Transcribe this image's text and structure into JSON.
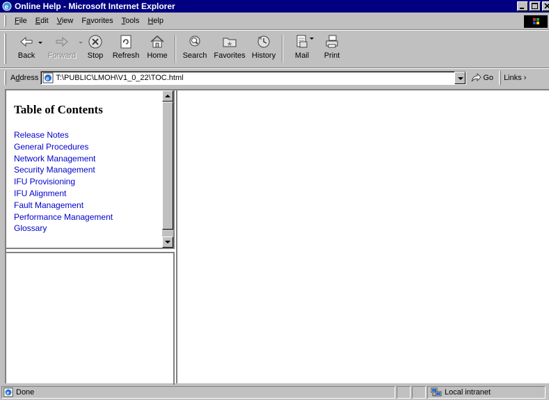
{
  "window": {
    "title": "Online Help - Microsoft Internet Explorer"
  },
  "menu": {
    "items": [
      {
        "key": "F",
        "rest": "ile"
      },
      {
        "key": "E",
        "rest": "dit"
      },
      {
        "key": "V",
        "rest": "iew"
      },
      {
        "pre": "F",
        "key": "a",
        "rest": "vorites"
      },
      {
        "key": "T",
        "rest": "ools"
      },
      {
        "key": "H",
        "rest": "elp"
      }
    ]
  },
  "toolbar": {
    "back": "Back",
    "forward": "Forward",
    "stop": "Stop",
    "refresh": "Refresh",
    "home": "Home",
    "search": "Search",
    "favorites": "Favorites",
    "history": "History",
    "mail": "Mail",
    "print": "Print"
  },
  "address": {
    "label_key": "d",
    "label_pre": "A",
    "label_rest": "dress",
    "value": "T:\\PUBLIC\\LMOH\\V1_0_22\\TOC.html",
    "go": "Go",
    "links": "Links"
  },
  "toc": {
    "heading": "Table of Contents",
    "links": [
      "Release Notes",
      "General Procedures",
      "Network Management",
      "Security Management",
      "IFU Provisioning",
      "IFU Alignment",
      "Fault Management",
      "Performance Management",
      "Glossary"
    ]
  },
  "status": {
    "text": "Done",
    "zone": "Local intranet"
  }
}
